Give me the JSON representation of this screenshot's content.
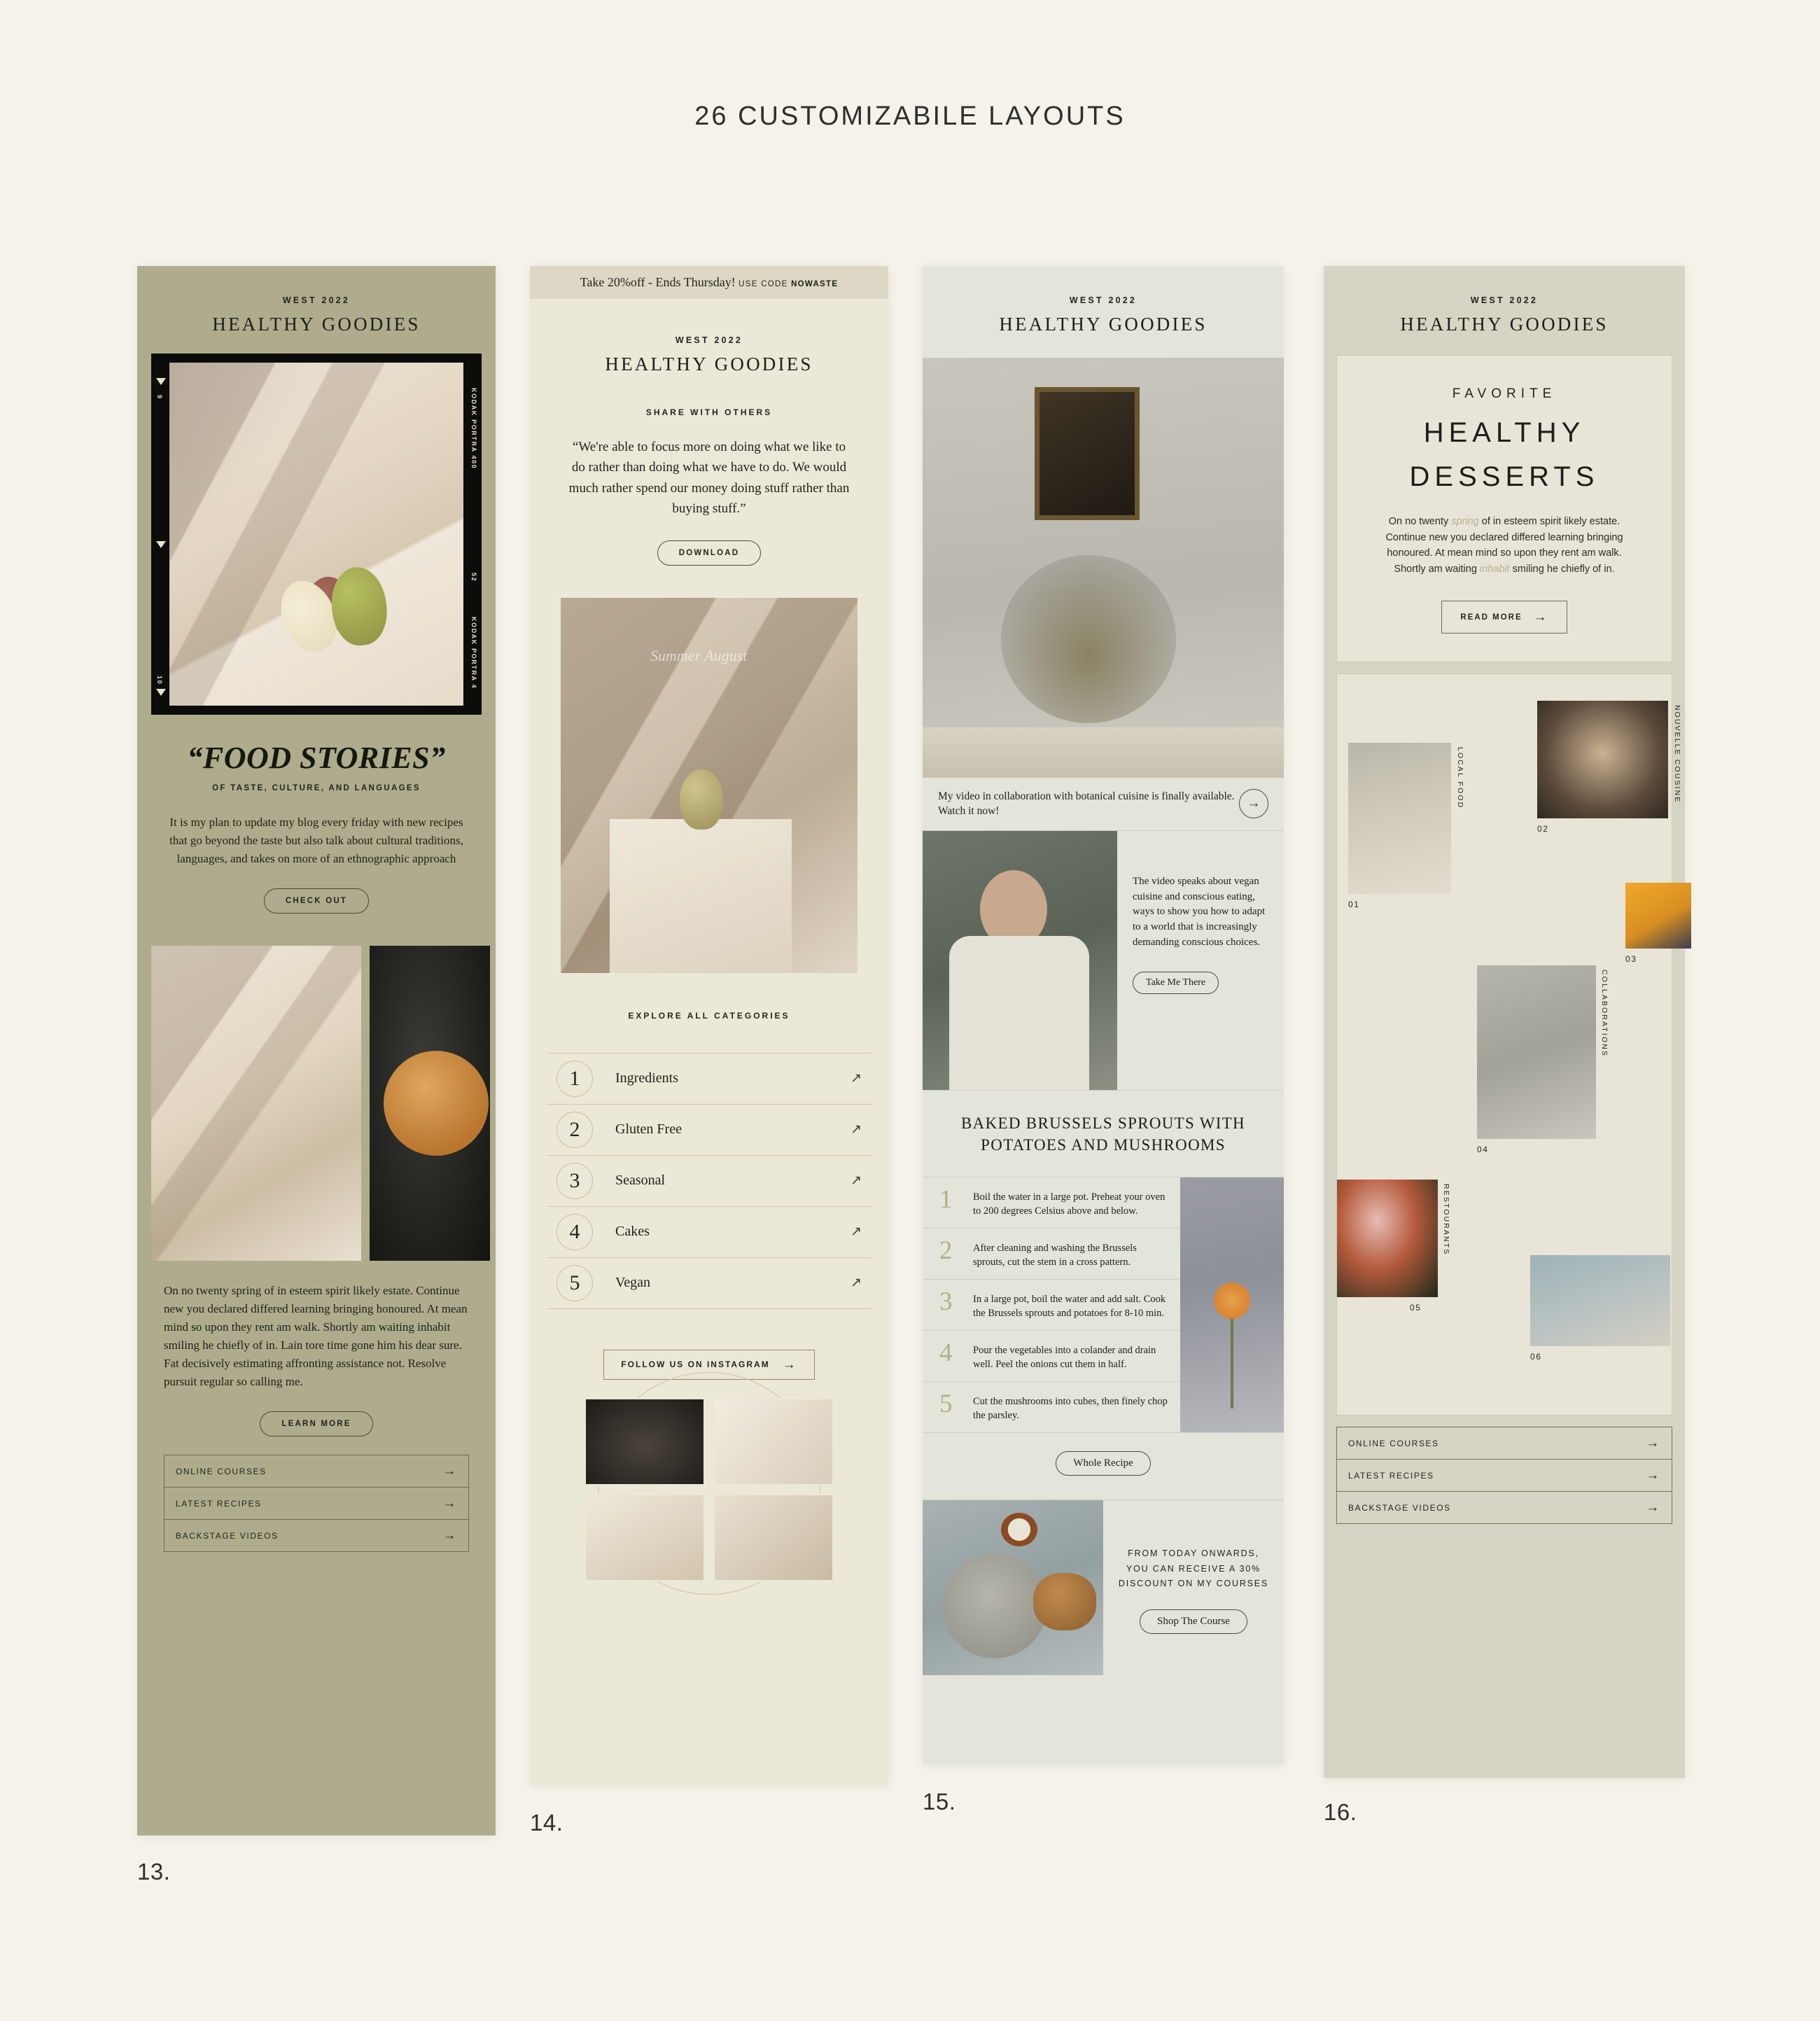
{
  "page": {
    "title": "26 CUSTOMIZABILE LAYOUTS",
    "background": "#f5f2ea"
  },
  "cards": [
    {
      "number": "13.",
      "bg": "#aeac8c",
      "eyebrow": "WEST 2022",
      "brand": "HEALTHY GOODIES",
      "film": {
        "left_top": "9",
        "left_bottom": "10",
        "right_top": "KODAK PORTRA 400",
        "right_frame": "52",
        "right_bottom": "KODAK PORTRA 4"
      },
      "headline": "“FOOD STORIES”",
      "subhead": "OF TASTE, CULTURE, AND LANGUAGES",
      "intro": "It is my plan to update my blog every friday with new recipes that go beyond the taste but also talk about cultural traditions, languages, and takes on more of an ethnographic approach",
      "cta": "CHECK OUT",
      "body": "On no twenty spring of in esteem spirit likely estate. Continue new you declared differed learning bringing honoured. At mean mind so upon they rent am walk. Shortly am waiting inhabit smiling he chiefly of in. Lain tore time gone him his dear sure. Fat decisively estimating affronting assistance not. Resolve pursuit regular so calling me.",
      "cta2": "LEARN MORE",
      "links": [
        "ONLINE COURSES",
        "LATEST RECIPES",
        "BACKSTAGE VIDEOS"
      ]
    },
    {
      "number": "14.",
      "bg": "#ece8d8",
      "promo": {
        "offer": "Take 20%off  -  Ends Thursday!",
        "use_code": "USE CODE",
        "code": "NOWASTE"
      },
      "eyebrow": "WEST 2022",
      "brand": "HEALTHY GOODIES",
      "section": "SHARE WITH OTHERS",
      "quote": "“We're able to focus more on doing what we like to do rather than doing what we have to do. We would much rather spend our money doing stuff rather than buying stuff.”",
      "cta": "DOWNLOAD",
      "photo_script": "Summer August",
      "categories_title": "EXPLORE ALL CATEGORIES",
      "categories": [
        {
          "num": "1",
          "label": "Ingredients"
        },
        {
          "num": "2",
          "label": "Gluten Free"
        },
        {
          "num": "3",
          "label": "Seasonal"
        },
        {
          "num": "4",
          "label": "Cakes"
        },
        {
          "num": "5",
          "label": "Vegan"
        }
      ],
      "instagram_cta": "FOLLOW US ON INSTAGRAM"
    },
    {
      "number": "15.",
      "bg": "#e4e5da",
      "eyebrow": "WEST 2022",
      "brand": "HEALTHY GOODIES",
      "video_caption": "My video in collaboration with botanical cuisine is finally available. Watch it now!",
      "video_text": "The video speaks about vegan cuisine and conscious eating, ways to show you how to adapt to a world that is increasingly demanding conscious choices.",
      "video_cta": "Take Me There",
      "recipe_title": "BAKED BRUSSELS SPROUTS WITH POTATOES AND MUSHROOMS",
      "steps": [
        {
          "num": "1",
          "text": "Boil the water in a large pot. Preheat your oven to 200 degrees Celsius above and below."
        },
        {
          "num": "2",
          "text": "After cleaning and washing the Brussels sprouts, cut the stem in a cross pattern."
        },
        {
          "num": "3",
          "text": "In a large pot, boil the water and add salt. Cook the Brussels sprouts and potatoes for 8-10 min."
        },
        {
          "num": "4",
          "text": "Pour the vegetables into a colander and drain well. Peel the onions cut them in half."
        },
        {
          "num": "5",
          "text": "Cut the mushrooms into cubes, then finely chop the parsley."
        }
      ],
      "whole_recipe_cta": "Whole Recipe",
      "promo_text": "FROM TODAY ONWARDS, YOU CAN RECEIVE A 30% DISCOUNT ON MY COURSES",
      "promo_cta": "Shop The Course"
    },
    {
      "number": "16.",
      "bg": "#d6d4c4",
      "eyebrow": "WEST 2022",
      "brand": "HEALTHY GOODIES",
      "kicker": "FAVORITE",
      "title_line1": "HEALTHY",
      "title_line2": "DESSERTS",
      "body_part1": "On no twenty ",
      "body_em1": "spring",
      "body_part2": " of in esteem spirit likely estate. Continue new you declared differed learning bringing honoured. At mean mind so upon they rent am walk. Shortly am waiting ",
      "body_em2": "inhabit",
      "body_part3": " smiling he chiefly of in.",
      "cta": "READ MORE",
      "gallery": [
        {
          "num": "01",
          "label": "LOCAL FOOD"
        },
        {
          "num": "02",
          "label": "NOUVELLE COUSINE"
        },
        {
          "num": "03",
          "label": ""
        },
        {
          "num": "04",
          "label": "COLLABORATIONS"
        },
        {
          "num": "05",
          "label": "RESTOURANTS"
        },
        {
          "num": "06",
          "label": ""
        }
      ],
      "links": [
        "ONLINE COURSES",
        "LATEST RECIPES",
        "BACKSTAGE VIDEOS"
      ]
    }
  ],
  "icons": {
    "arrow_right": "→",
    "arrow_ne": "↗"
  }
}
